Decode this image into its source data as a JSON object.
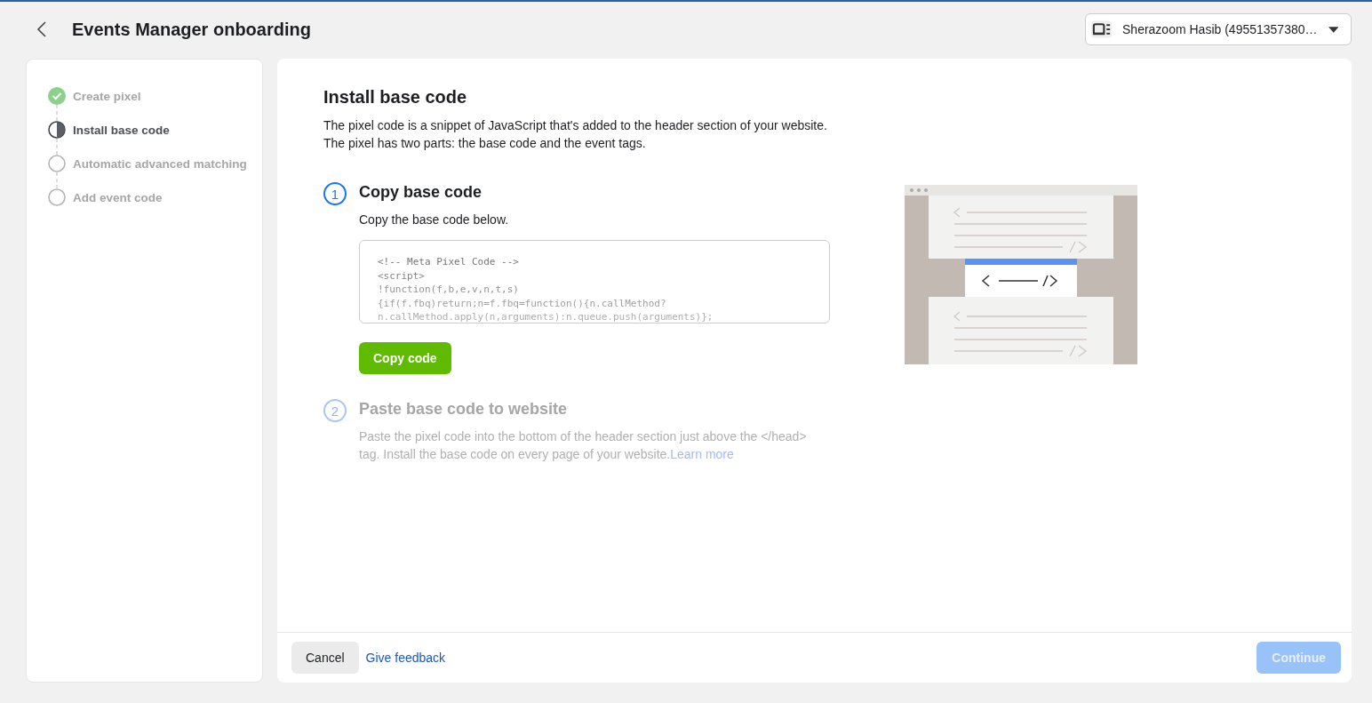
{
  "header": {
    "title": "Events Manager onboarding",
    "account": {
      "label": "Sherazoom Hasib (49551357380…"
    }
  },
  "steps": [
    {
      "label": "Create pixel",
      "kind": "done"
    },
    {
      "label": "Install base code",
      "kind": "current"
    },
    {
      "label": "Automatic advanced matching",
      "kind": "todo"
    },
    {
      "label": "Add event code",
      "kind": "todo"
    }
  ],
  "main": {
    "title": "Install base code",
    "intro": [
      "The pixel code is a snippet of JavaScript that's added to the header section of your website.",
      "The pixel has two parts: the base code and the event tags."
    ],
    "sections": [
      {
        "number": "1",
        "title": "Copy base code",
        "active": true,
        "text": "Copy the base code below.",
        "code": [
          "<!-- Meta Pixel Code -->",
          "<script>",
          "!function(f,b,e,v,n,t,s)",
          "{if(f.fbq)return;n=f.fbq=function(){n.callMethod?",
          "n.callMethod.apply(n,arguments):n.queue.push(arguments)};"
        ],
        "button": "Copy code"
      },
      {
        "number": "2",
        "title": "Paste base code to website",
        "active": false,
        "text": "Paste the pixel code into the bottom of the header section just above the </head> tag. Install the base code on every page of your website.",
        "link": "Learn more"
      }
    ]
  },
  "footer": {
    "cancel": "Cancel",
    "feedback": "Give feedback",
    "continue": {
      "label": "Continue",
      "disabled": true
    }
  }
}
